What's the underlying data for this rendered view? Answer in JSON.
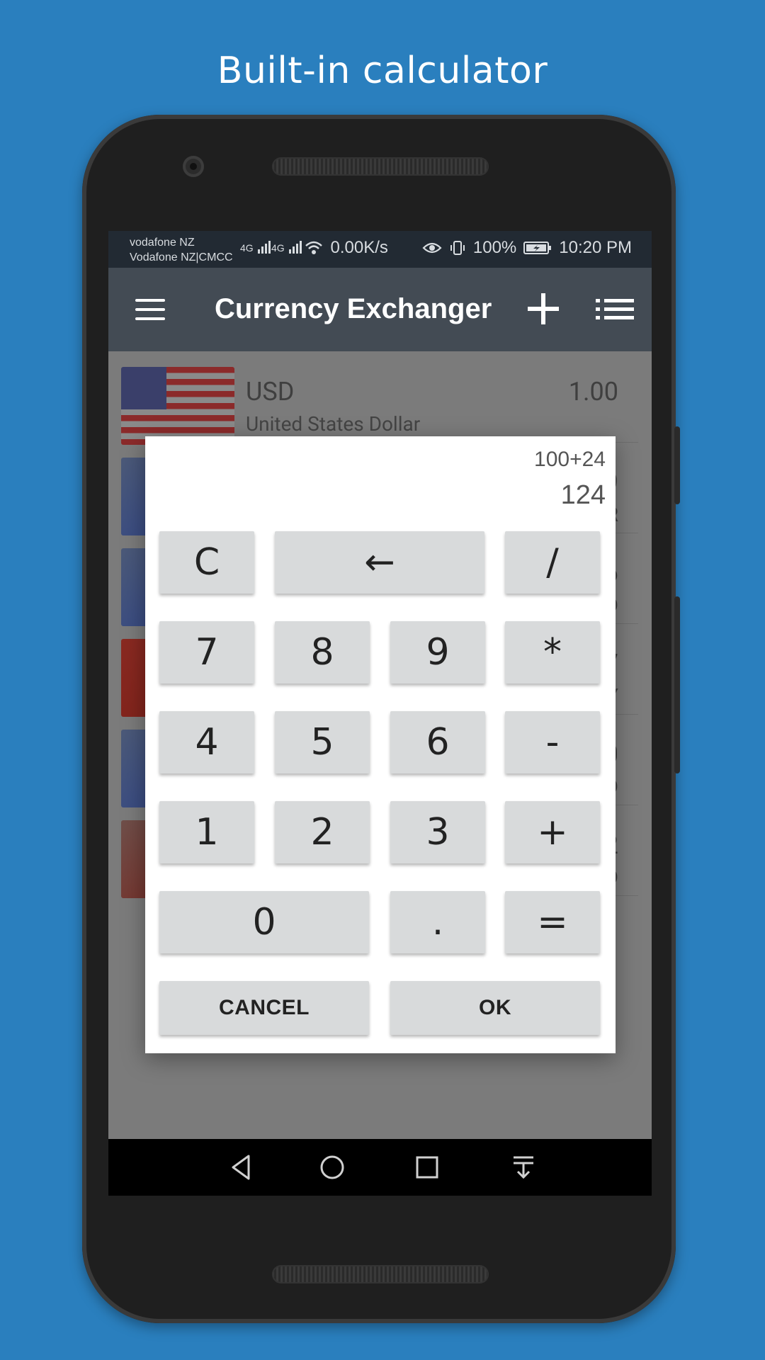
{
  "headline": "Built-in calculator",
  "status_bar": {
    "carrier_line1": "vodafone NZ",
    "carrier_line2": "Vodafone NZ|CMCC",
    "signal1": "4G",
    "signal2": "4G",
    "speed": "0.00K/s",
    "battery": "100%",
    "time": "10:20 PM"
  },
  "toolbar": {
    "title": "Currency Exchanger"
  },
  "list": [
    {
      "code": "USD",
      "name": "United States Dollar",
      "value": "1.00",
      "sub": ""
    },
    {
      "code": "",
      "name": "",
      "value": "9",
      "sub": "R"
    },
    {
      "code": "",
      "name": "",
      "value": "6",
      "sub": "D"
    },
    {
      "code": "",
      "name": "",
      "value": "7",
      "sub": "Y"
    },
    {
      "code": "",
      "name": "",
      "value": "0",
      "sub": "D"
    },
    {
      "code": "",
      "name": "",
      "value": "2",
      "sub": "D"
    }
  ],
  "calculator": {
    "expression": "100+24",
    "result": "124",
    "keys": {
      "clear": "C",
      "backspace": "←",
      "divide": "/",
      "seven": "7",
      "eight": "8",
      "nine": "9",
      "multiply": "*",
      "four": "4",
      "five": "5",
      "six": "6",
      "minus": "-",
      "one": "1",
      "two": "2",
      "three": "3",
      "plus": "+",
      "zero": "0",
      "dot": ".",
      "equals": "="
    },
    "cancel_label": "CANCEL",
    "ok_label": "OK"
  },
  "colors": {
    "background": "#2a7fbe",
    "toolbar": "#434b54",
    "status_bar": "#222a33",
    "key": "#d8dadb"
  }
}
